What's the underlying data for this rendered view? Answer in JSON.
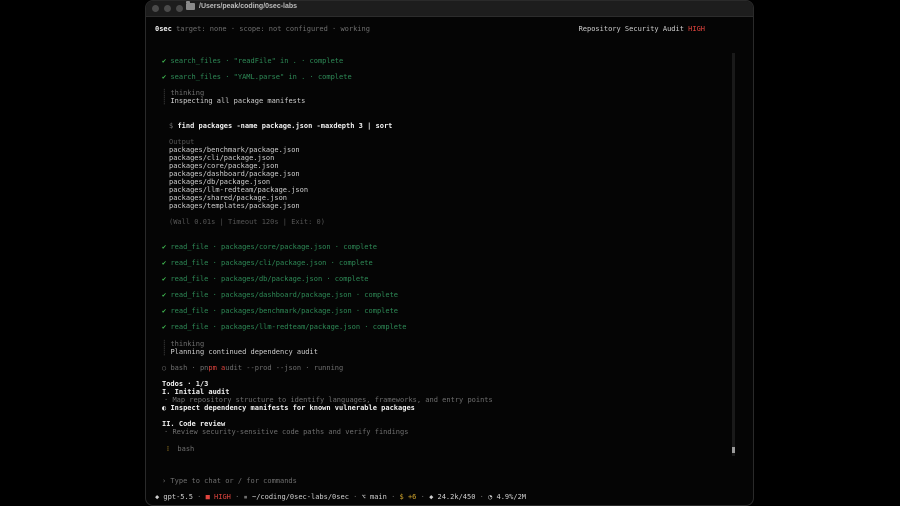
{
  "window": {
    "title": "/Users/peak/coding/0sec-labs"
  },
  "header": {
    "app": "0sec",
    "status": "target: none · scope: not configured · working",
    "mode": "Repository Security Audit",
    "badge": "HIGH"
  },
  "log": {
    "search1": {
      "text": "search_files · \"readFile\" in . · complete"
    },
    "search2": {
      "text": "search_files · \"YAML.parse\" in . · complete"
    },
    "thinking1": {
      "label": "thinking",
      "text": "Inspecting all package manifests"
    },
    "command": {
      "prompt": "$",
      "text": "find packages -name package.json -maxdepth 3 | sort"
    },
    "output": {
      "label": "Output",
      "lines": [
        "packages/benchmark/package.json",
        "packages/cli/package.json",
        "packages/core/package.json",
        "packages/dashboard/package.json",
        "packages/db/package.json",
        "packages/llm-redteam/package.json",
        "packages/shared/package.json",
        "packages/templates/package.json"
      ],
      "footer": "(Wall 0.01s | Timeout 120s | Exit: 0)"
    },
    "reads": [
      "read_file · packages/core/package.json · complete",
      "read_file · packages/cli/package.json · complete",
      "read_file · packages/db/package.json · complete",
      "read_file · packages/dashboard/package.json · complete",
      "read_file · packages/benchmark/package.json · complete",
      "read_file · packages/llm-redteam/package.json · complete"
    ],
    "thinking2": {
      "label": "thinking",
      "text": "Planning continued dependency audit"
    },
    "bash_pre": "bash · pn",
    "bash_mid": "pm a",
    "bash_post": "udit --prod --json · running"
  },
  "todos": {
    "header": "Todos · 1/3",
    "sections": [
      {
        "title": "I. Initial audit",
        "items": [
          {
            "text": "Map repository structure to identify languages, frameworks, and entry points",
            "marker": "·"
          },
          {
            "text": "Inspect dependency manifests for known vulnerable packages",
            "marker": "◐"
          }
        ]
      },
      {
        "title": "II. Code review",
        "items": [
          {
            "text": "Review security-sensitive code paths and verify findings",
            "marker": "·"
          }
        ]
      }
    ],
    "pending_tool": "bash"
  },
  "input": {
    "placeholder": "› Type to chat or / for commands"
  },
  "statusbar": {
    "model": "◆ gpt-5.5",
    "level": "■ HIGH",
    "path": "~/coding/0sec-labs/0sec",
    "branch": "⌥ main",
    "dollar": "$",
    "changes": "+6",
    "tokens": "◆ 24.2k/450",
    "context": "◔ 4.9%/2M",
    "sep": "·"
  }
}
